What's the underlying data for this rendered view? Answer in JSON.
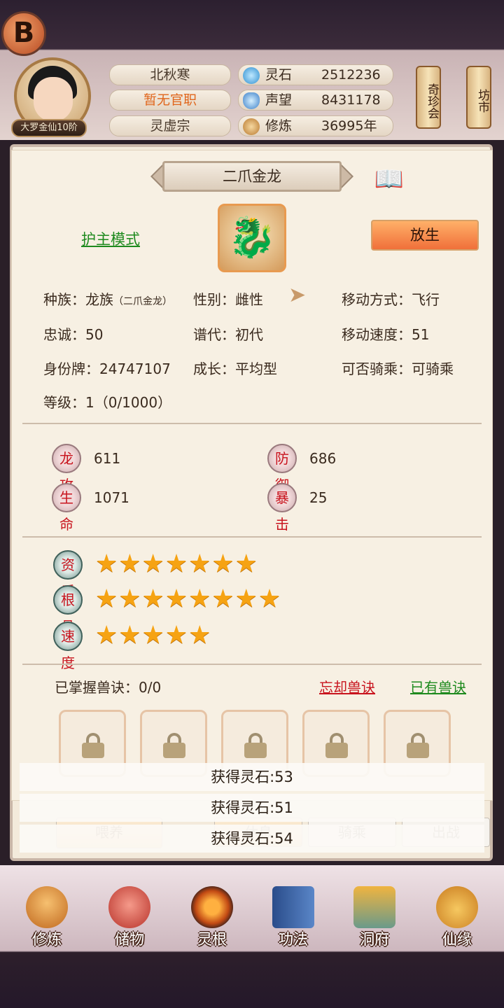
{
  "header": {
    "logo_text": "B",
    "rank": "大罗金仙10阶",
    "player_name": "北秋寒",
    "official_post": "暂无官职",
    "sect": "灵虚宗",
    "resources": [
      {
        "icon": "spirit-stone-icon",
        "label": "灵石",
        "value": "2512236"
      },
      {
        "icon": "prestige-icon",
        "label": "声望",
        "value": "8431178"
      },
      {
        "icon": "cultivation-icon",
        "label": "修炼",
        "value": "36995年"
      }
    ],
    "side_buttons": [
      "奇珍会",
      "坊市"
    ]
  },
  "pet": {
    "title": "二爪金龙",
    "mode_link": "护主模式",
    "release_button": "放生",
    "info": {
      "race_label": "种族：",
      "race_value": "龙族",
      "race_sub": "（二爪金龙）",
      "gender": "性别：雌性",
      "move_mode": "移动方式：飞行",
      "loyalty": "忠诚：50",
      "generation": "谱代：初代",
      "move_speed": "移动速度：51",
      "id_tag": "身份牌：24747107",
      "growth": "成长：平均型",
      "rideable": "可否骑乘：可骑乘",
      "level": "等级：1（0/1000）"
    },
    "stats": [
      {
        "label": "龙攻",
        "value": "611"
      },
      {
        "label": "防御",
        "value": "686"
      },
      {
        "label": "生命",
        "value": "1071"
      },
      {
        "label": "暴击",
        "value": "25"
      }
    ],
    "attributes": [
      {
        "label": "资质",
        "stars": 7,
        "stars_text": "★★★★★★★"
      },
      {
        "label": "根骨",
        "stars": 8,
        "stars_text": "★★★★★★★★"
      },
      {
        "label": "速度",
        "stars": 5,
        "stars_text": "★★★★★"
      }
    ],
    "skills": {
      "mastered": "已掌握兽诀：0/0",
      "forget_link": "忘却兽诀",
      "owned_link": "已有兽诀",
      "slot_count": 5
    }
  },
  "toasts": [
    "获得灵石:53",
    "获得灵石:51",
    "获得灵石:54"
  ],
  "actions": [
    "喂养",
    "休息",
    "骑乘",
    "出战"
  ],
  "nav": [
    {
      "icon": "cultivate-icon",
      "label": "修炼"
    },
    {
      "icon": "storage-bag-icon",
      "label": "储物"
    },
    {
      "icon": "spirit-root-icon",
      "label": "灵根"
    },
    {
      "icon": "technique-book-icon",
      "label": "功法"
    },
    {
      "icon": "cave-mansion-icon",
      "label": "洞府"
    },
    {
      "icon": "gourd-icon",
      "label": "仙缘"
    }
  ],
  "colors": {
    "accent_orange": "#f0703a",
    "star": "#f6a313",
    "link_green": "#1e8a1e",
    "link_red": "#c8141e"
  }
}
